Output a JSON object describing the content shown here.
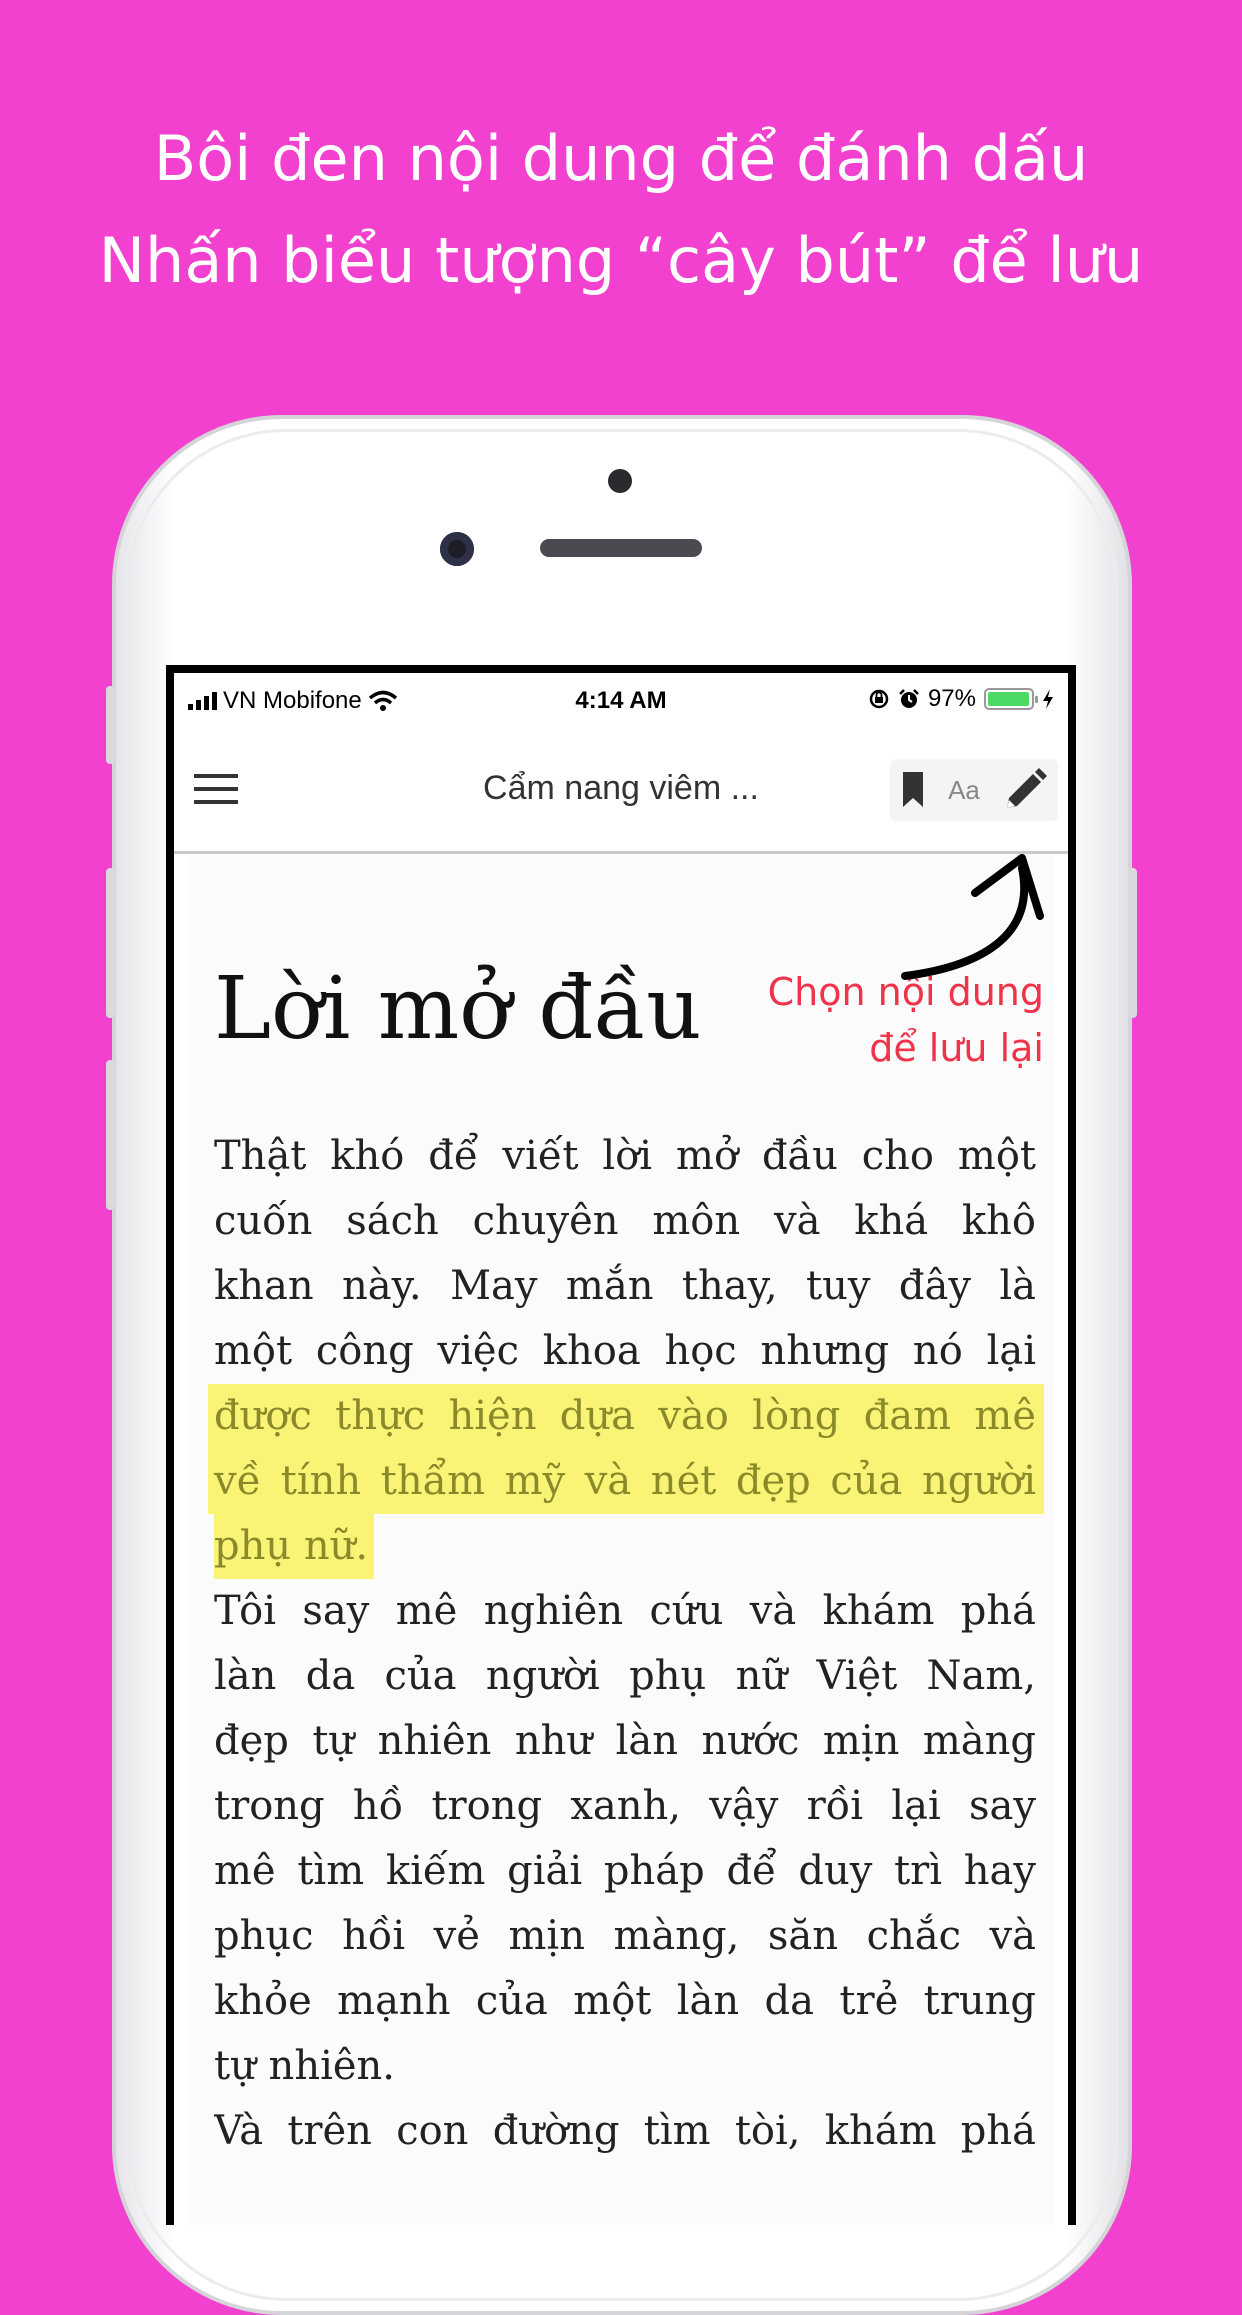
{
  "caption": {
    "line1": "Bôi đen nội dung để đánh dấu",
    "line2": "Nhấn biểu tượng “cây bút” để lưu"
  },
  "status_bar": {
    "carrier": "VN Mobifone",
    "time": "4:14 AM",
    "battery_percent": "97%",
    "battery_level": 0.97,
    "icons": [
      "signal-icon",
      "wifi-icon",
      "rotation-lock-icon",
      "alarm-icon",
      "battery-icon",
      "charging-icon"
    ]
  },
  "navbar": {
    "menu_icon": "hamburger-icon",
    "title": "Cẩm nang viêm ...",
    "font_button": "Aa",
    "tools": [
      "bookmark-icon",
      "font-size-button",
      "pencil-icon"
    ]
  },
  "article": {
    "heading": "Lời mở đầu",
    "lines": [
      "Thật khó để viết lời mở đầu cho một",
      "cuốn sách chuyên môn và khá khô",
      "khan này. May mắn thay, tuy đây là",
      "một công việc khoa học nhưng nó lại",
      "được thực hiện dựa vào lòng đam mê",
      "về tính thẩm mỹ và nét đẹp của người",
      "phụ nữ.",
      "Tôi say mê nghiên cứu và khám phá",
      "làn da của người phụ nữ Việt Nam,",
      "đẹp tự nhiên như làn nước mịn màng",
      "trong hồ trong xanh, vậy rồi lại say",
      "mê tìm kiếm giải pháp để duy trì hay",
      "phục hồi vẻ mịn màng, săn chắc và",
      "khỏe mạnh của một làn da trẻ trung",
      "tự nhiên.",
      "Và trên con đường tìm tòi, khám phá"
    ]
  },
  "annotation": {
    "line1": "Chọn nội dung",
    "line2": "để lưu lại",
    "color": "#f0334a"
  },
  "colors": {
    "background": "#f240cf",
    "highlight": "#faf476",
    "highlight_text": "#8a8a2a"
  }
}
